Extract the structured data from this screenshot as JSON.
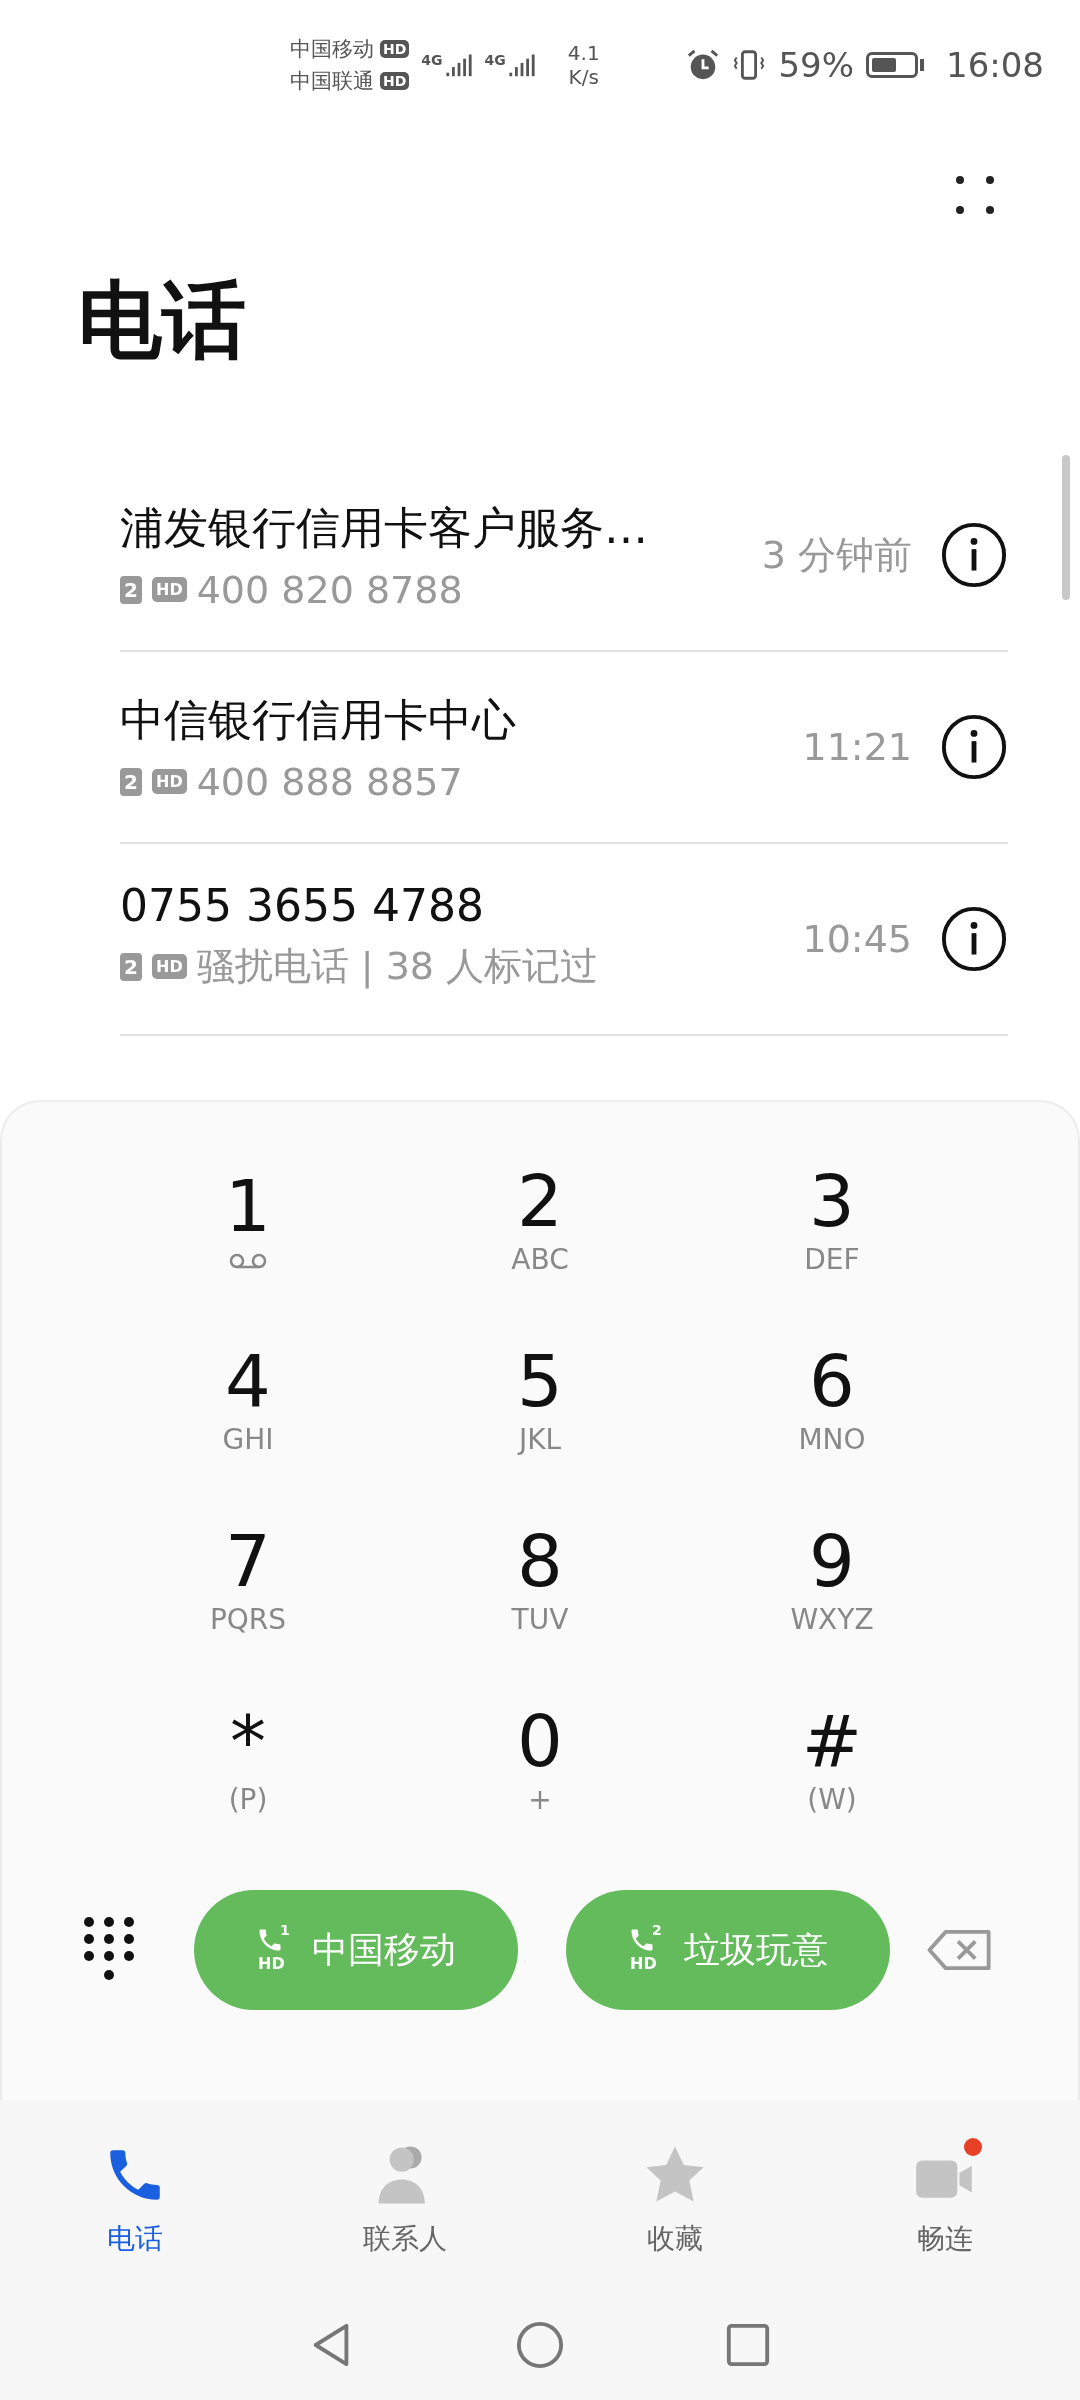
{
  "status_bar": {
    "carriers": [
      {
        "name": "中国移动",
        "hd": "HD"
      },
      {
        "name": "中国联通",
        "hd": "HD"
      }
    ],
    "networks": [
      "4G",
      "4G"
    ],
    "speed_value": "4.1",
    "speed_unit": "K/s",
    "battery_text": "59%",
    "time": "16:08"
  },
  "title": "电话",
  "calls": [
    {
      "name": "浦发银行信用卡客户服务…",
      "sim": "2",
      "hd": "HD",
      "detail": "400 820 8788",
      "time": "3 分钟前"
    },
    {
      "name": "中信银行信用卡中心",
      "sim": "2",
      "hd": "HD",
      "detail": "400 888 8857",
      "time": "11:21"
    },
    {
      "name": "0755 3655 4788",
      "sim": "2",
      "hd": "HD",
      "detail": "骚扰电话 | 38 人标记过",
      "time": "10:45"
    }
  ],
  "keypad": [
    {
      "kind": "voicemail",
      "digit": "1"
    },
    {
      "kind": "letters",
      "digit": "2",
      "sub": "ABC"
    },
    {
      "kind": "letters",
      "digit": "3",
      "sub": "DEF"
    },
    {
      "kind": "letters",
      "digit": "4",
      "sub": "GHI"
    },
    {
      "kind": "letters",
      "digit": "5",
      "sub": "JKL"
    },
    {
      "kind": "letters",
      "digit": "6",
      "sub": "MNO"
    },
    {
      "kind": "letters",
      "digit": "7",
      "sub": "PQRS"
    },
    {
      "kind": "letters",
      "digit": "8",
      "sub": "TUV"
    },
    {
      "kind": "letters",
      "digit": "9",
      "sub": "WXYZ"
    },
    {
      "kind": "letters",
      "digit": "*",
      "sub": "(P)"
    },
    {
      "kind": "letters",
      "digit": "0",
      "sub": "+"
    },
    {
      "kind": "letters",
      "digit": "#",
      "sub": "(W)"
    }
  ],
  "call_buttons": [
    {
      "label": "中国移动",
      "sim": "1",
      "hd": "HD"
    },
    {
      "label": "垃圾玩意",
      "sim": "2",
      "hd": "HD"
    }
  ],
  "tabs": [
    {
      "kind": "phone",
      "label": "电话",
      "selected": true,
      "notification_dot": false
    },
    {
      "kind": "contacts",
      "label": "联系人",
      "selected": false,
      "notification_dot": false
    },
    {
      "kind": "favorites",
      "label": "收藏",
      "selected": false,
      "notification_dot": false
    },
    {
      "kind": "video",
      "label": "畅连",
      "selected": false,
      "notification_dot": true
    }
  ]
}
